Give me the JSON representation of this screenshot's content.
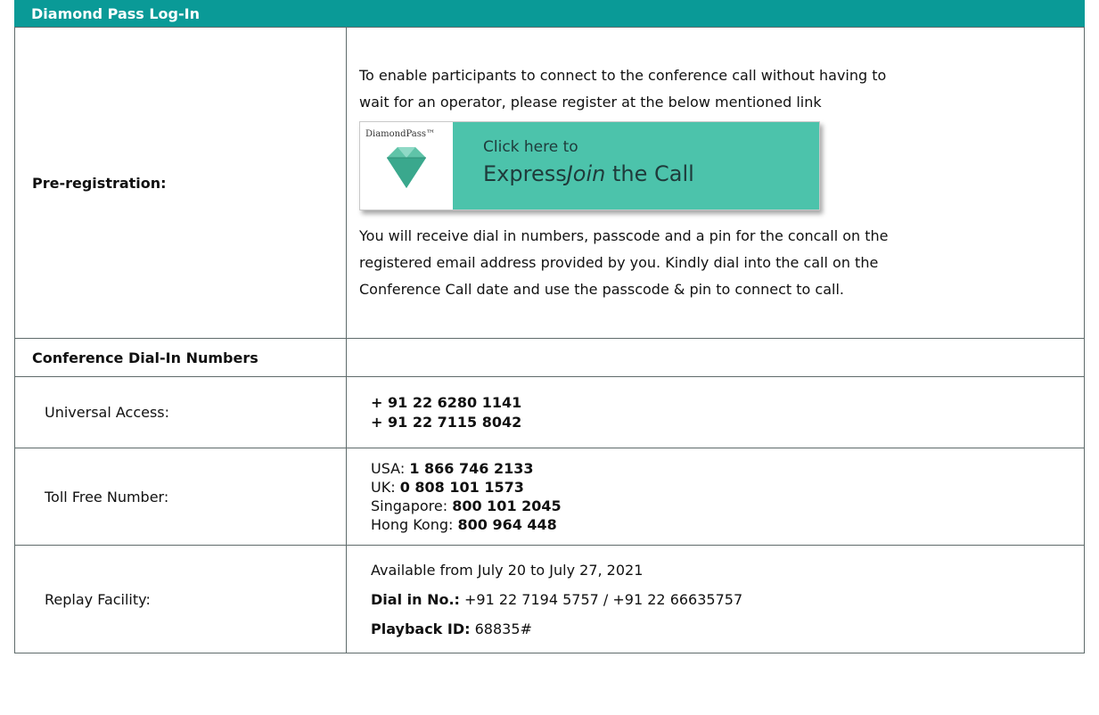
{
  "header": {
    "title": "Diamond Pass Log-In"
  },
  "pre_registration": {
    "label": "Pre-registration:",
    "intro_line1": "To enable participants to connect to the conference call without having to",
    "intro_line2": "wait for an operator, please register at the below mentioned link",
    "card": {
      "brand": "DiamondPass™",
      "line1": "Click here to",
      "line2_a": "Express",
      "line2_b": "Join",
      "line2_c": " the Call"
    },
    "after_line1": "You will receive dial in numbers, passcode and a pin for the concall on the",
    "after_line2": "registered email address provided by you. Kindly dial into the call on the",
    "after_line3": "Conference Call date and use the passcode & pin to connect to call."
  },
  "dial_in": {
    "title": "Conference Dial-In Numbers"
  },
  "universal": {
    "label": "Universal Access:",
    "numbers": [
      "+ 91 22 6280 1141",
      "+ 91 22 7115 8042"
    ]
  },
  "toll_free": {
    "label": "Toll Free Number:",
    "rows": [
      {
        "country": "USA: ",
        "number": "1 866 746 2133"
      },
      {
        "country": "UK: ",
        "number": "0 808 101 1573"
      },
      {
        "country": "Singapore: ",
        "number": "800 101 2045"
      },
      {
        "country": "Hong Kong: ",
        "number": "800 964 448"
      }
    ]
  },
  "replay": {
    "label": "Replay Facility:",
    "availability": "Available from July 20 to July 27, 2021",
    "dial_label": "Dial in No.:",
    "dial_value": " +91 22 7194 5757 / +91 22 66635757",
    "playback_label": "Playback ID:",
    "playback_value": " 68835#"
  },
  "colors": {
    "header_bg": "#0a9a97",
    "card_bg": "#4cc3ab",
    "gem": "#5fc3a8"
  }
}
